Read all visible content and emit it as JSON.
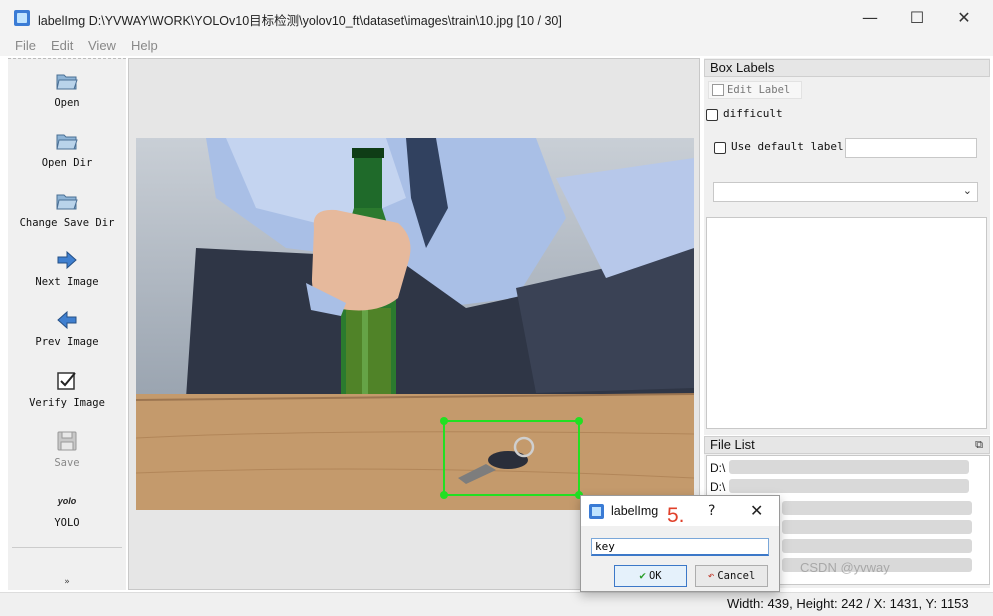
{
  "window": {
    "title": "labelImg D:\\YVWAY\\WORK\\YOLOv10目标检测\\yolov10_ft\\dataset\\images\\train\\10.jpg [10 / 30]",
    "minimize": "—",
    "maximize": "☐",
    "close": "✕"
  },
  "menu": {
    "file": "File",
    "edit": "Edit",
    "view": "View",
    "help": "Help"
  },
  "toolbar": {
    "items": [
      {
        "label": "Open",
        "icon": "folder-open-icon",
        "enabled": true
      },
      {
        "label": "Open Dir",
        "icon": "folder-open-icon",
        "enabled": true
      },
      {
        "label": "Change Save Dir",
        "icon": "folder-open-icon",
        "enabled": true
      },
      {
        "label": "Next Image",
        "icon": "arrow-right-icon",
        "enabled": true
      },
      {
        "label": "Prev Image",
        "icon": "arrow-left-icon",
        "enabled": true
      },
      {
        "label": "Verify Image",
        "icon": "checkbox-icon",
        "enabled": true
      },
      {
        "label": "Save",
        "icon": "save-icon",
        "enabled": false
      },
      {
        "label": "YOLO",
        "icon": "yolo-icon",
        "icon_text": "yolo",
        "enabled": true
      }
    ],
    "more": "»"
  },
  "box_labels": {
    "title": "Box Labels",
    "edit_label": "Edit Label",
    "difficult": "difficult",
    "use_default_label": "Use default label",
    "default_label_value": "",
    "combo_value": ""
  },
  "file_list": {
    "title": "File List",
    "items": [
      "D:\\",
      "D:\\"
    ]
  },
  "status": {
    "text": "Width: 439, Height: 242 / X: 1431, Y: 1153"
  },
  "dialog": {
    "title": "labelImg",
    "step": "5.",
    "help": "?",
    "close": "✕",
    "input_value": "key",
    "ok": "OK",
    "cancel": "Cancel"
  },
  "watermark": "CSDN @yvway"
}
